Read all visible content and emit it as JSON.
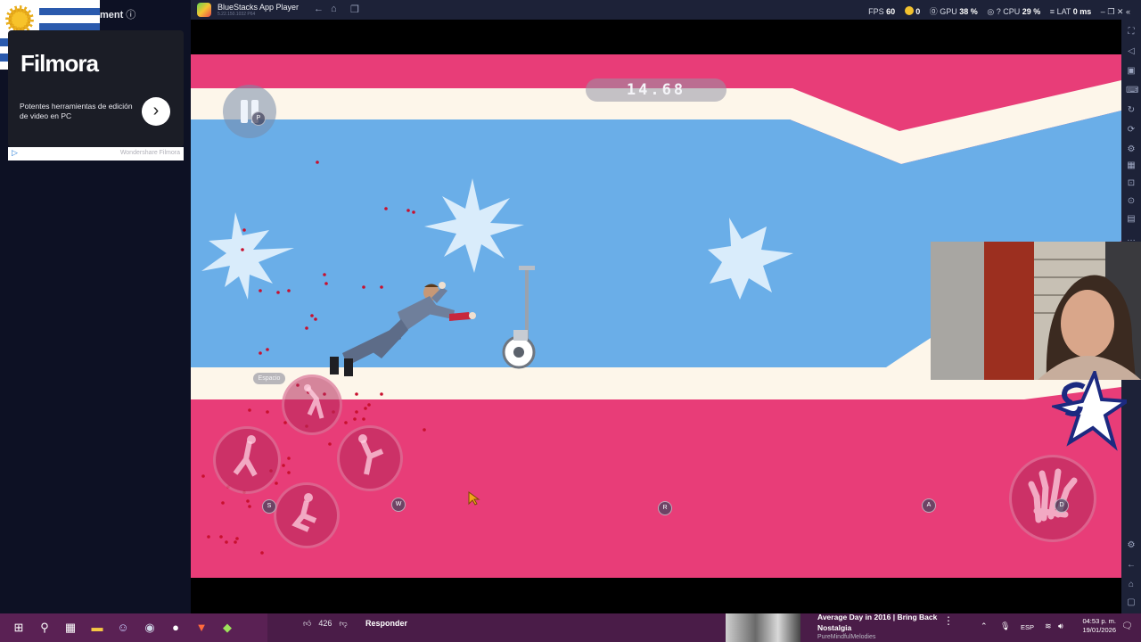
{
  "ad": {
    "header_text": "ment",
    "header_info_icon": "info-icon",
    "brand": "Filmora",
    "description": "Potentes herramientas de edición de video en PC",
    "go_icon": "chevron-right-icon",
    "adchoices_icon": "adchoices-icon",
    "sponsor": "Wondershare Filmora"
  },
  "titlebar": {
    "app_title": "BlueStacks App Player",
    "version": "5.22.150.1032 P64",
    "stats": {
      "fps_label": "FPS",
      "fps_value": "60",
      "coins": "0",
      "gpu_label": "GPU",
      "gpu_value": "38 %",
      "cpu_label": "CPU",
      "cpu_value": "29 %",
      "lat_label": "LAT",
      "lat_value": "0 ms"
    }
  },
  "game": {
    "timer": "14.68",
    "pause_key": "P",
    "space_key": "Espacio",
    "keys": {
      "s": "S",
      "w": "W",
      "r": "R",
      "a": "A",
      "d": "D"
    }
  },
  "taskbar": {
    "like_count": "426",
    "reply_label": "Responder",
    "video_title": "Average Day in 2016 | Bring Back Nostalgia",
    "video_channel": "PureMindfulMelodies",
    "lang": "ESP",
    "time": "04:53 p. m.",
    "date": "19/01/2026"
  },
  "colors": {
    "pink": "#e83d78",
    "sky": "#6aaee8",
    "cream": "#fdf6ea",
    "titlebar": "#1d2238"
  }
}
